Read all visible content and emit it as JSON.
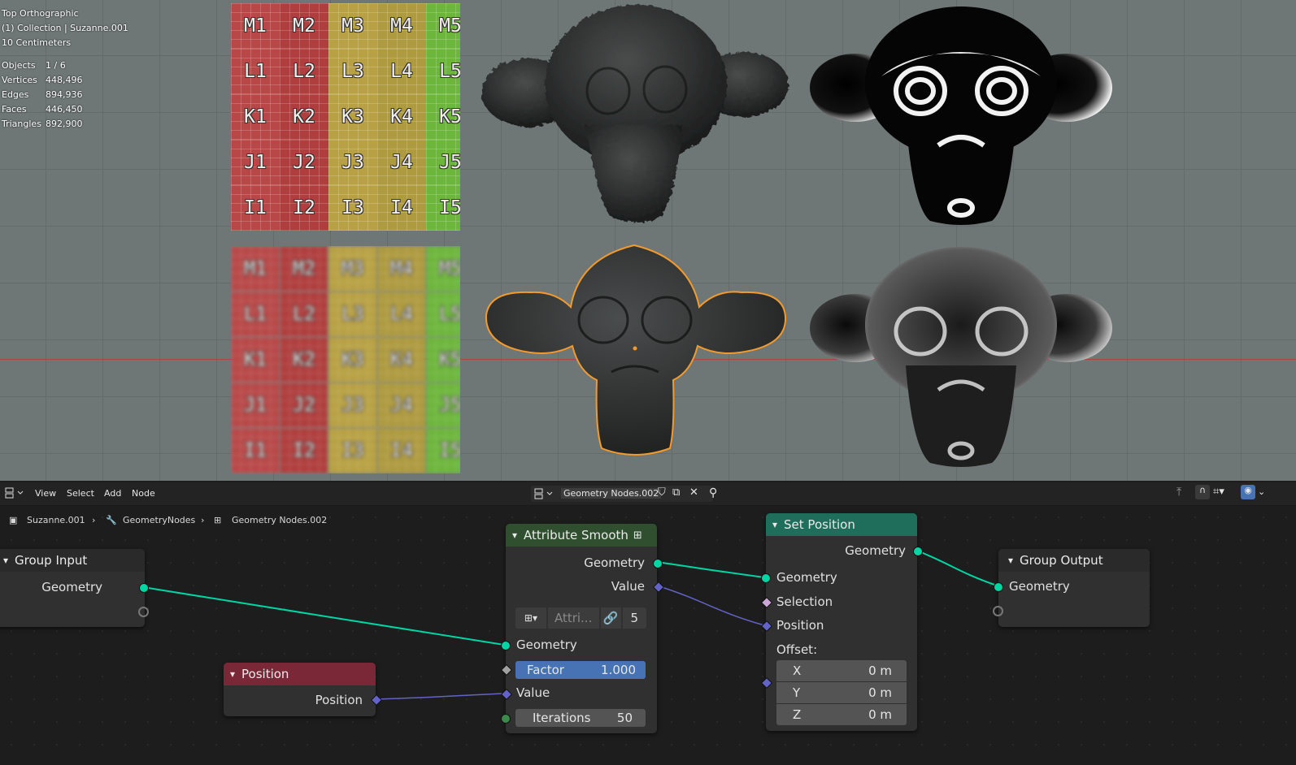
{
  "viewport": {
    "view_name": "Top Orthographic",
    "collection": "(1) Collection | Suzanne.001",
    "scale": "10 Centimeters",
    "stats": [
      {
        "label": "Objects",
        "value": "1 / 6"
      },
      {
        "label": "Vertices",
        "value": "448,496"
      },
      {
        "label": "Edges",
        "value": "894,936"
      },
      {
        "label": "Faces",
        "value": "446,450"
      },
      {
        "label": "Triangles",
        "value": "892,900"
      }
    ],
    "uv_labels": [
      [
        "M1",
        "M2",
        "M3",
        "M4",
        "M5"
      ],
      [
        "L1",
        "L2",
        "L3",
        "L4",
        "L5"
      ],
      [
        "K1",
        "K2",
        "K3",
        "K4",
        "K5"
      ],
      [
        "J1",
        "J2",
        "J3",
        "J4",
        "J5"
      ],
      [
        "I1",
        "I2",
        "I3",
        "I4",
        "I5"
      ]
    ],
    "colors": {
      "red": "#b84848",
      "yellow": "#b8a144",
      "green": "#6db63c",
      "selection_outline": "#f29a2e"
    }
  },
  "header": {
    "menu": [
      "View",
      "Select",
      "Add",
      "Node"
    ],
    "node_tree_name": "Geometry Nodes.002"
  },
  "breadcrumb": [
    "Suzanne.001",
    "GeometryNodes",
    "Geometry Nodes.002"
  ],
  "nodes": {
    "group_input": {
      "title": "Group Input",
      "geometry": "Geometry"
    },
    "position": {
      "title": "Position",
      "output": "Position"
    },
    "attribute_smooth": {
      "title": "Attribute Smooth",
      "out_geometry": "Geometry",
      "out_value": "Value",
      "attr_placeholder": "Attri...",
      "attr_count": "5",
      "in_geometry": "Geometry",
      "factor_label": "Factor",
      "factor_value": "1.000",
      "in_value": "Value",
      "iterations_label": "Iterations",
      "iterations_value": "50"
    },
    "set_position": {
      "title": "Set Position",
      "out_geometry": "Geometry",
      "in_geometry": "Geometry",
      "selection": "Selection",
      "position": "Position",
      "offset_label": "Offset:",
      "offset": [
        {
          "axis": "X",
          "value": "0 m"
        },
        {
          "axis": "Y",
          "value": "0 m"
        },
        {
          "axis": "Z",
          "value": "0 m"
        }
      ]
    },
    "group_output": {
      "title": "Group Output",
      "geometry": "Geometry"
    }
  },
  "node_colors": {
    "geometry_link": "#00d6a3",
    "vector_link": "#6363c7",
    "smooth_header": "#2f4f2f",
    "setpos_header": "#1f6e5c",
    "position_header": "#7a2838"
  }
}
